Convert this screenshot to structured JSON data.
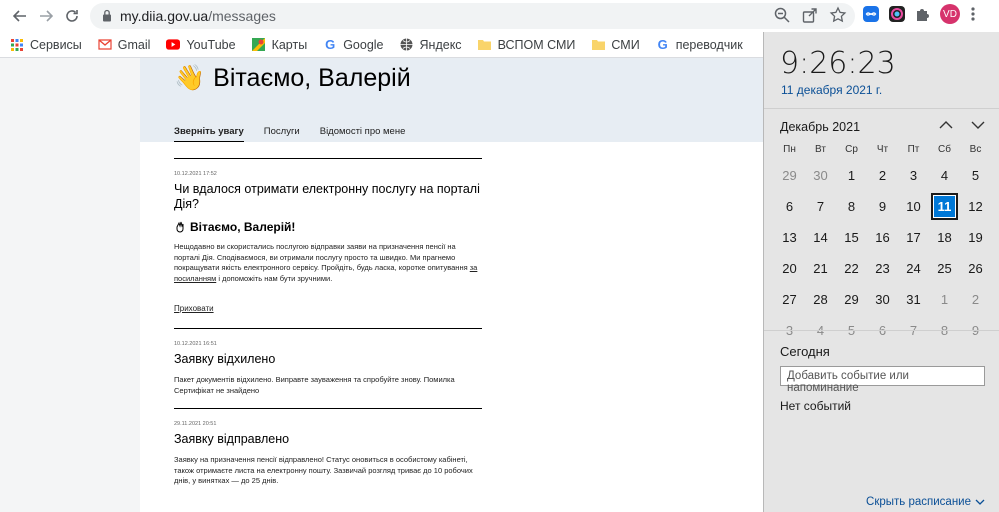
{
  "browser": {
    "url_host": "my.diia.gov.ua",
    "url_path": "/messages",
    "avatar_initials": "VD",
    "bookmarks": [
      {
        "label": "Сервисы",
        "icon": "apps-grid-icon"
      },
      {
        "label": "Gmail",
        "icon": "gmail-icon"
      },
      {
        "label": "YouTube",
        "icon": "youtube-icon"
      },
      {
        "label": "Карты",
        "icon": "maps-icon"
      },
      {
        "label": "Google",
        "icon": "google-icon"
      },
      {
        "label": "Яндекс",
        "icon": "globe-icon"
      },
      {
        "label": "ВСПОМ СМИ",
        "icon": "folder-icon"
      },
      {
        "label": "СМИ",
        "icon": "folder-icon"
      },
      {
        "label": "переводчик",
        "icon": "google-icon"
      }
    ]
  },
  "page": {
    "greeting_emoji": "👋",
    "greeting": "Вітаємо, Валерій",
    "tabs": [
      "Зверніть увагу",
      "Послуги",
      "Відомості про мене"
    ],
    "messages": [
      {
        "date": "10.12.2021 17:52",
        "title": "Чи вдалося отримати електронну послугу на порталі Дія?",
        "greeting": "Вітаємо, Валерій!",
        "text_before_link": "Нещодавно ви скористались послугою відправки заяви на призначення пенсії на порталі Дія. Сподіваємося, ви отримали послугу просто та швидко. Ми прагнемо покращувати якість електронного сервісу. Пройдіть, будь ласка, коротке опитування ",
        "link": "за посиланням",
        "text_after_link": " і допоможіть нам бути зручними.",
        "hide": "Приховати"
      },
      {
        "date": "10.12.2021 16:51",
        "title": "Заявку відхилено",
        "text": "Пакет документів відхилено. Виправте зауваження та спробуйте знову. Помилка Сертифікат не знайдено"
      },
      {
        "date": "29.11.2021 20:51",
        "title": "Заявку відправлено",
        "text": "Заявку на призначення пенсії відправлено! Статус оновиться в особистому кабінеті, також отримаєте листа на електронну пошту. Зазвичай розгляд триває до 10 робочих днів, у винятках — до 25 днів."
      }
    ]
  },
  "calendar": {
    "time": "9:26:23",
    "long_date": "11 декабря 2021 г.",
    "month": "Декабрь 2021",
    "weekdays": [
      "Пн",
      "Вт",
      "Ср",
      "Чт",
      "Пт",
      "Сб",
      "Вс"
    ],
    "days": [
      {
        "d": "29",
        "muted": true
      },
      {
        "d": "30",
        "muted": true
      },
      {
        "d": "1"
      },
      {
        "d": "2"
      },
      {
        "d": "3"
      },
      {
        "d": "4"
      },
      {
        "d": "5"
      },
      {
        "d": "6"
      },
      {
        "d": "7"
      },
      {
        "d": "8"
      },
      {
        "d": "9"
      },
      {
        "d": "10"
      },
      {
        "d": "11",
        "today": true
      },
      {
        "d": "12"
      },
      {
        "d": "13"
      },
      {
        "d": "14"
      },
      {
        "d": "15"
      },
      {
        "d": "16"
      },
      {
        "d": "17"
      },
      {
        "d": "18"
      },
      {
        "d": "19"
      },
      {
        "d": "20"
      },
      {
        "d": "21"
      },
      {
        "d": "22"
      },
      {
        "d": "23"
      },
      {
        "d": "24"
      },
      {
        "d": "25"
      },
      {
        "d": "26"
      },
      {
        "d": "27"
      },
      {
        "d": "28"
      },
      {
        "d": "29"
      },
      {
        "d": "30"
      },
      {
        "d": "31"
      },
      {
        "d": "1",
        "muted": true
      },
      {
        "d": "2",
        "muted": true
      },
      {
        "d": "3",
        "muted": true
      },
      {
        "d": "4",
        "muted": true
      },
      {
        "d": "5",
        "muted": true
      },
      {
        "d": "6",
        "muted": true
      },
      {
        "d": "7",
        "muted": true
      },
      {
        "d": "8",
        "muted": true
      },
      {
        "d": "9",
        "muted": true
      }
    ],
    "today_label": "Сегодня",
    "event_placeholder": "Добавить событие или напоминание",
    "no_events": "Нет событий",
    "schedule_link": "Скрыть расписание"
  }
}
